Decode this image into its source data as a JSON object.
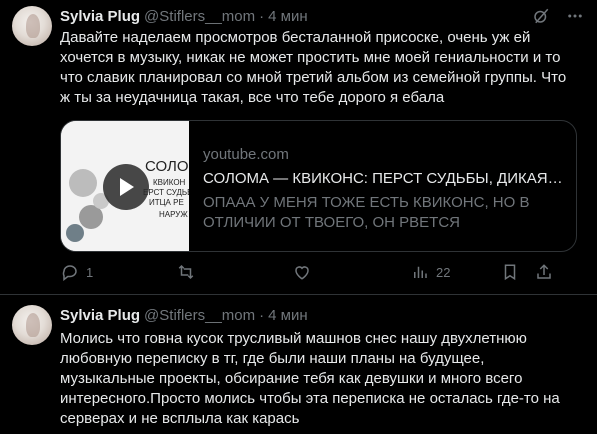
{
  "tweets": [
    {
      "author_name": "Sylvia Plug",
      "handle": "@Stiflers__mom",
      "separator": "·",
      "time": "4 мин",
      "text": "Давайте наделаем просмотров бесталанной присоске, очень уж ей хочется в музыку, никак не может простить мне моей гениальности и то что славик планировал со мной третий альбом из семейной группы. Что ж ты за неудачница такая, все что тебе дорого я ебала",
      "card": {
        "domain": "youtube.com",
        "title": "СОЛОМА — КВИКОНС: ПЕРСТ СУДЬБЫ, ДИКАЯ ПТ...",
        "description": "ОПААА У МЕНЯ ТОЖЕ ЕСТЬ КВИКОНС, НО В ОТЛИЧИИ ОТ ТВОЕГО, ОН РВЕТСЯ НАРУЖУСлушат...",
        "thumb_text": [
          "СОЛОМ",
          "КВИКОН",
          "ЕРСТ СУДЬБ",
          "ИТЦА РЕ",
          "НАРУЖ"
        ]
      },
      "actions": {
        "replies": "1",
        "reposts": "",
        "likes": "",
        "views": "22"
      }
    },
    {
      "author_name": "Sylvia Plug",
      "handle": "@Stiflers__mom",
      "separator": "·",
      "time": "4 мин",
      "text": "Молись что говна кусок трусливый машнов снес нашу двухлетнюю любовную переписку в тг, где были наши планы на будущее, музыкальные проекты, обсирание тебя как девушки и много всего интересного.Просто молись чтобы эта переписка не осталась где-то на серверах и не всплыла как карась"
    }
  ],
  "colors": {
    "background": "#000000",
    "text": "#e7e9ea",
    "muted": "#71767b",
    "border": "#2f3336"
  }
}
